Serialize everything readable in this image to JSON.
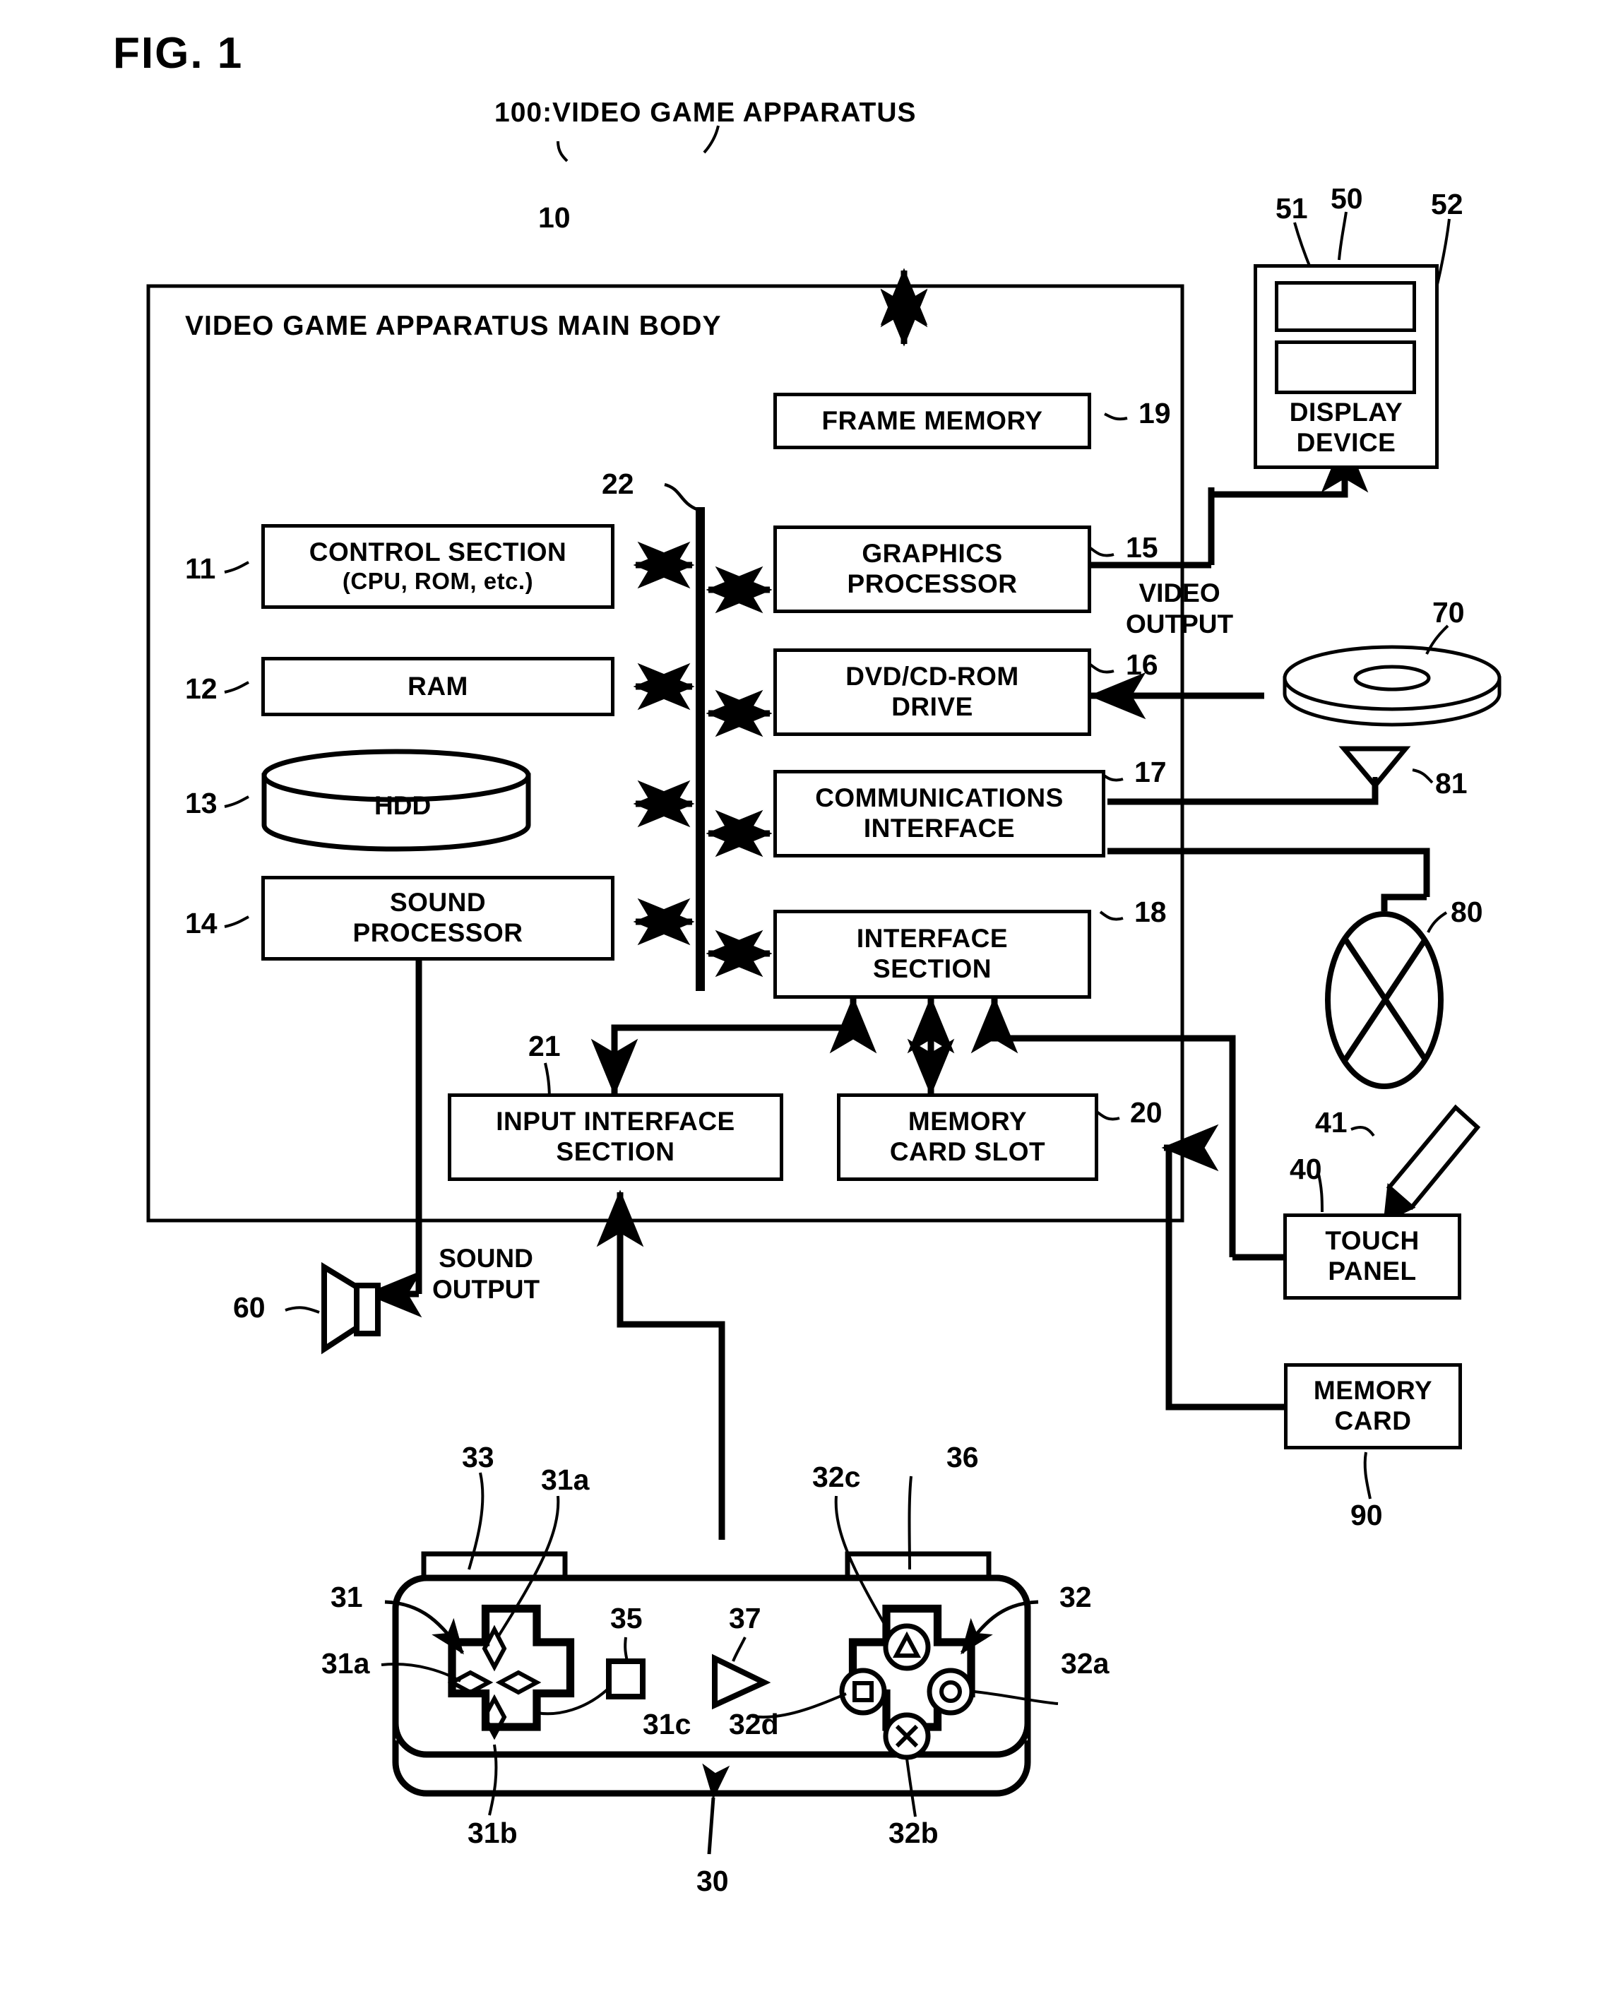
{
  "figure": {
    "title": "FIG. 1",
    "system_label": "100:VIDEO GAME APPARATUS"
  },
  "main_body": {
    "label": "VIDEO GAME APPARATUS MAIN BODY",
    "ref": "10"
  },
  "blocks": [
    {
      "id": "control-section",
      "ref": "11",
      "line1": "CONTROL SECTION",
      "line2": "(CPU, ROM, etc.)"
    },
    {
      "id": "ram",
      "ref": "12",
      "line1": "RAM",
      "line2": ""
    },
    {
      "id": "hdd",
      "ref": "13",
      "line1": "HDD",
      "line2": ""
    },
    {
      "id": "sound-processor",
      "ref": "14",
      "line1": "SOUND",
      "line2": "PROCESSOR"
    },
    {
      "id": "graphics-processor",
      "ref": "15",
      "line1": "GRAPHICS",
      "line2": "PROCESSOR"
    },
    {
      "id": "dvd-cd-rom-drive",
      "ref": "16",
      "line1": "DVD/CD-ROM",
      "line2": "DRIVE"
    },
    {
      "id": "communications-interface",
      "ref": "17",
      "line1": "COMMUNICATIONS",
      "line2": "INTERFACE"
    },
    {
      "id": "interface-section",
      "ref": "18",
      "line1": "INTERFACE",
      "line2": "SECTION"
    },
    {
      "id": "frame-memory",
      "ref": "19",
      "line1": "FRAME MEMORY",
      "line2": ""
    },
    {
      "id": "memory-card-slot",
      "ref": "20",
      "line1": "MEMORY",
      "line2": "CARD SLOT"
    },
    {
      "id": "input-interface-section",
      "ref": "21",
      "line1": "INPUT INTERFACE",
      "line2": "SECTION"
    },
    {
      "id": "display-device",
      "ref": "50",
      "line1": "DISPLAY",
      "line2": "DEVICE"
    },
    {
      "id": "touch-panel",
      "ref": "40",
      "line1": "TOUCH",
      "line2": "PANEL"
    },
    {
      "id": "memory-card",
      "ref": "90",
      "line1": "MEMORY",
      "line2": "CARD"
    }
  ],
  "bus": {
    "ref": "22"
  },
  "signal_labels": {
    "video_output_line1": "VIDEO",
    "video_output_line2": "OUTPUT",
    "sound_output_line1": "SOUND",
    "sound_output_line2": "OUTPUT"
  },
  "peripheral_refs": {
    "display_screen_upper": "51",
    "display_screen_lower": "52",
    "disc": "70",
    "antenna": "81",
    "network_symbol": "80",
    "touch_panel": "40",
    "stylus": "41",
    "speaker": "60",
    "memory_card": "90"
  },
  "controller": {
    "ref": "30",
    "body_ref_left": "31",
    "body_ref_right": "32",
    "shoulder_left": "33",
    "shoulder_right": "36",
    "dpad_left_refs": [
      "31a",
      "31a",
      "31b",
      "31c"
    ],
    "buttons_right_refs": [
      "32a",
      "32b",
      "32c",
      "32d"
    ],
    "select_button": "35",
    "start_button": "37",
    "labels": {
      "l31": "31",
      "l31a_top": "31a",
      "l31a_left": "31a",
      "l31b": "31b",
      "l31c": "31c",
      "l32": "32",
      "l32a": "32a",
      "l32b": "32b",
      "l32c": "32c",
      "l32d": "32d",
      "l33": "33",
      "l35": "35",
      "l36": "36",
      "l37": "37",
      "l30": "30"
    }
  },
  "colors": {
    "ink": "#000000",
    "paper": "#ffffff"
  }
}
